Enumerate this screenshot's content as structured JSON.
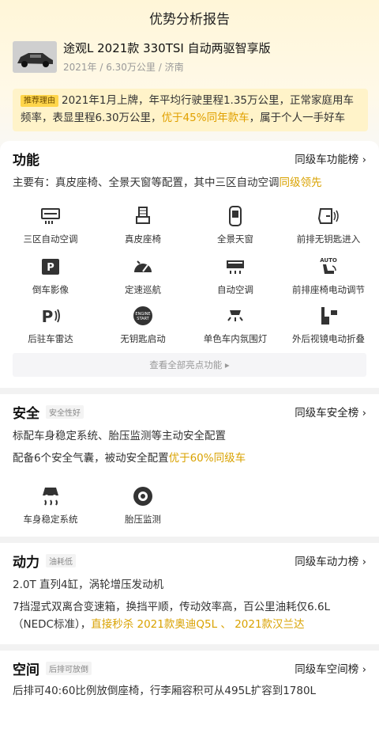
{
  "page_title": "优势分析报告",
  "car": {
    "name": "途观L 2021款 330TSI 自动两驱智享版",
    "meta": "2021年 / 6.30万公里 / 济南"
  },
  "recommend": {
    "tag": "推荐理由",
    "text_pre": "2021年1月上牌，年平均行驶里程1.35万公里，正常家庭用车频率，表显里程6.30万公里，",
    "highlight": "优于45%同年款车",
    "text_post": "，属于个人一手好车"
  },
  "function": {
    "title": "功能",
    "link": "同级车功能榜 ›",
    "desc_pre": "主要有：真皮座椅、全景天窗等配置，其中三区自动空调",
    "desc_hl": "同级领先",
    "features": [
      {
        "label": "三区自动空调",
        "icon": "climate-icon"
      },
      {
        "label": "真皮座椅",
        "icon": "seat-icon"
      },
      {
        "label": "全景天窗",
        "icon": "sunroof-icon"
      },
      {
        "label": "前排无钥匙进入",
        "icon": "keyless-entry-icon"
      },
      {
        "label": "倒车影像",
        "icon": "parking-camera-icon"
      },
      {
        "label": "定速巡航",
        "icon": "cruise-control-icon"
      },
      {
        "label": "自动空调",
        "icon": "auto-ac-icon"
      },
      {
        "label": "前排座椅电动调节",
        "icon": "power-seat-icon"
      },
      {
        "label": "后驻车雷达",
        "icon": "parking-radar-icon"
      },
      {
        "label": "无钥匙启动",
        "icon": "start-stop-icon"
      },
      {
        "label": "单色车内氛围灯",
        "icon": "ambient-light-icon"
      },
      {
        "label": "外后视镜电动折叠",
        "icon": "mirror-fold-icon"
      }
    ],
    "more": "查看全部亮点功能 ▸"
  },
  "safety": {
    "title": "安全",
    "badge": "安全性好",
    "link": "同级车安全榜 ›",
    "line1": "标配车身稳定系统、胎压监测等主动安全配置",
    "line2_pre": "配备6个安全气囊，被动安全配置",
    "line2_hl": "优于60%同级车",
    "features": [
      {
        "label": "车身稳定系统",
        "icon": "stability-control-icon"
      },
      {
        "label": "胎压监测",
        "icon": "tire-pressure-icon"
      }
    ]
  },
  "power": {
    "title": "动力",
    "badge": "油耗低",
    "link": "同级车动力榜 ›",
    "line1": "2.0T 直列4缸，涡轮增压发动机",
    "line2": "7挡湿式双离合变速箱，换挡平顺，传动效率高，百公里油耗仅6.6L（NEDC标准），",
    "line2_hl": "直接秒杀 2021款奥迪Q5L",
    "sep": " 、 ",
    "line2_hl2": "2021款汉兰达"
  },
  "space": {
    "title": "空间",
    "badge": "后排可放倒",
    "link": "同级车空间榜 ›",
    "line1": "后排可40:60比例放倒座椅，行李厢容积可从495L扩容到1780L"
  },
  "colors": {
    "accent": "#d9a200",
    "tag_bg": "#ffd54a",
    "rec_bg": "#fff3c9"
  }
}
